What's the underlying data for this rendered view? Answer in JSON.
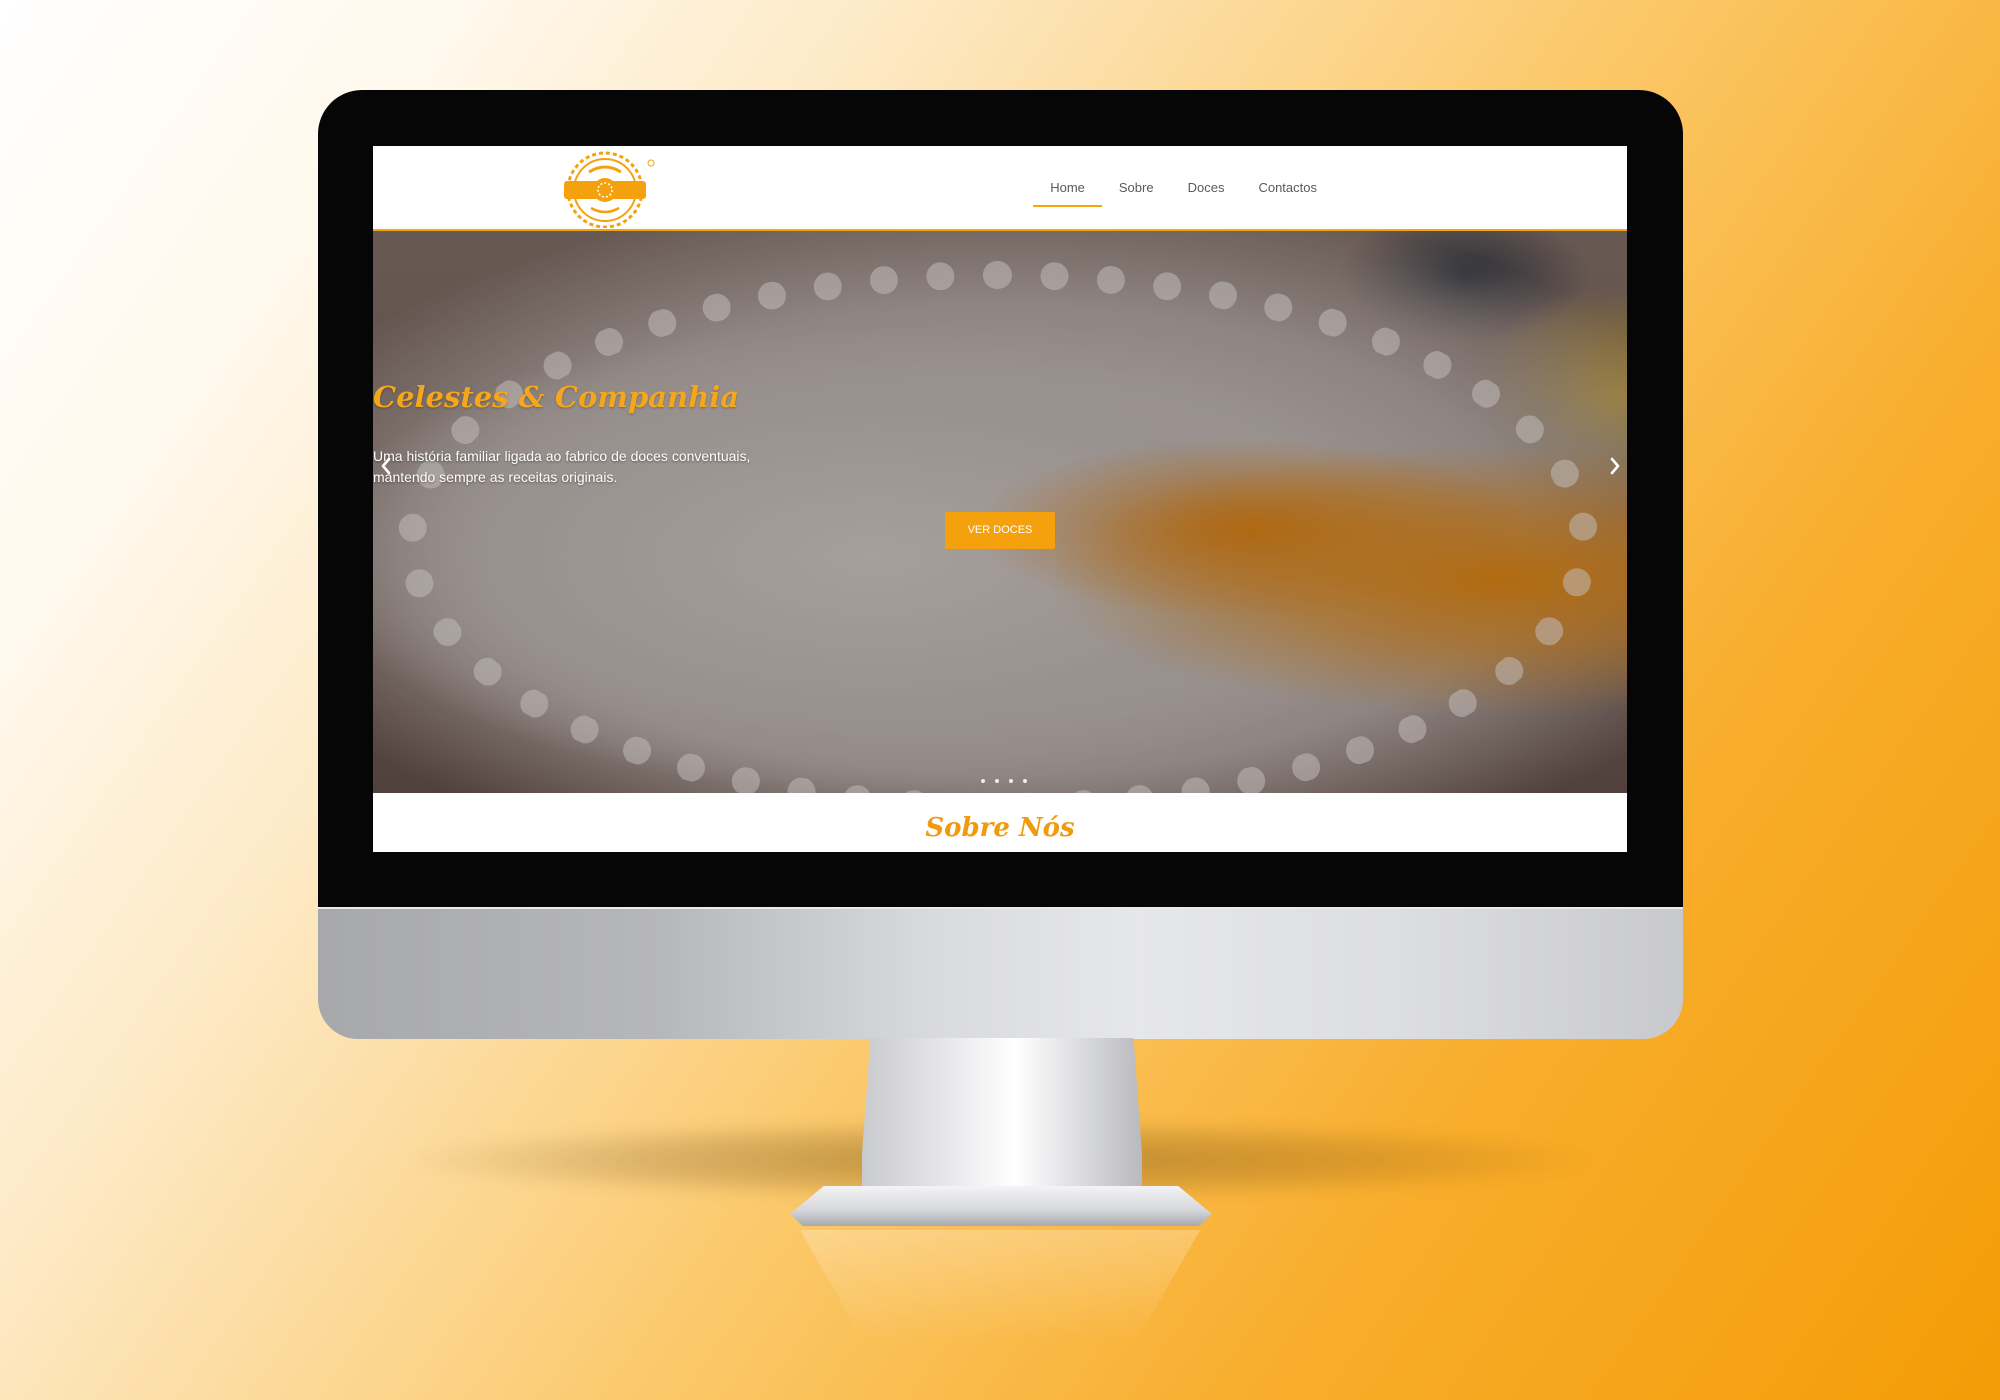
{
  "nav": {
    "items": [
      {
        "label": "Home",
        "active": true
      },
      {
        "label": "Sobre",
        "active": false
      },
      {
        "label": "Doces",
        "active": false
      },
      {
        "label": "Contactos",
        "active": false
      }
    ]
  },
  "hero": {
    "title": "Celestes & Companhia",
    "subtitle_line1": "Uma história familiar ligada ao fabrico de doces conventuais,",
    "subtitle_line2": "mantendo sempre as receitas originais.",
    "button_label": "VER DOCES",
    "slides_count": 4,
    "prev_icon": "chevron-left-icon",
    "next_icon": "chevron-right-icon"
  },
  "about": {
    "title": "Sobre Nós"
  },
  "colors": {
    "accent": "#f5a10d",
    "header_border": "#f5a70a",
    "nav_text": "#5a5a5a"
  }
}
